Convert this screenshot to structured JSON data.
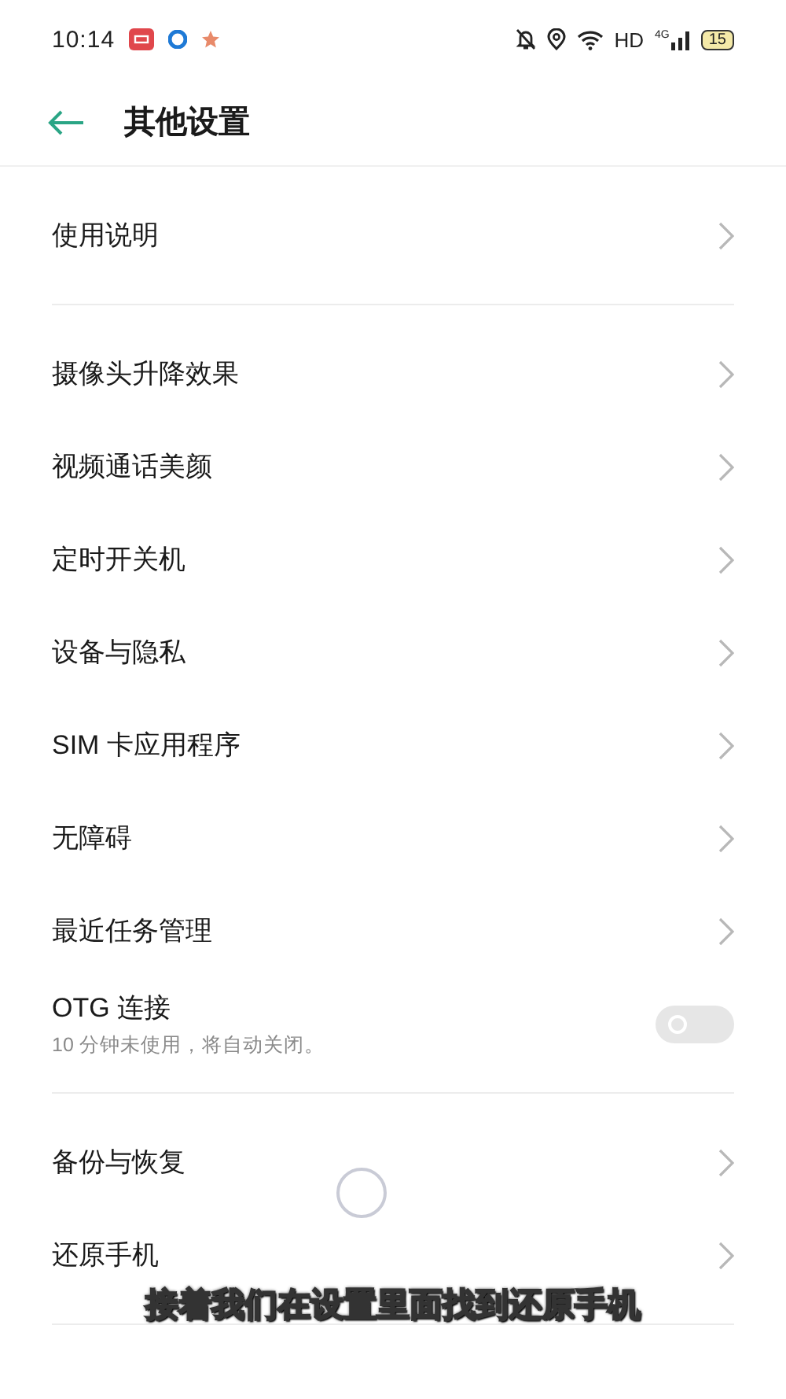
{
  "status_bar": {
    "time": "10:14",
    "network": "HD",
    "signal_type": "4G",
    "battery": "15"
  },
  "header": {
    "title": "其他设置"
  },
  "sections": [
    {
      "items": [
        {
          "kind": "link",
          "label": "使用说明"
        }
      ]
    },
    {
      "items": [
        {
          "kind": "link",
          "label": "摄像头升降效果"
        },
        {
          "kind": "link",
          "label": "视频通话美颜"
        },
        {
          "kind": "link",
          "label": "定时开关机"
        },
        {
          "kind": "link",
          "label": "设备与隐私"
        },
        {
          "kind": "link",
          "label": "SIM 卡应用程序"
        },
        {
          "kind": "link",
          "label": "无障碍"
        },
        {
          "kind": "link",
          "label": "最近任务管理"
        },
        {
          "kind": "toggle",
          "label": "OTG 连接",
          "description": "10 分钟未使用，将自动关闭。",
          "on": false
        }
      ]
    },
    {
      "items": [
        {
          "kind": "link",
          "label": "备份与恢复"
        },
        {
          "kind": "link",
          "label": "还原手机"
        }
      ]
    }
  ],
  "caption": "接着我们在设置里面找到还原手机"
}
